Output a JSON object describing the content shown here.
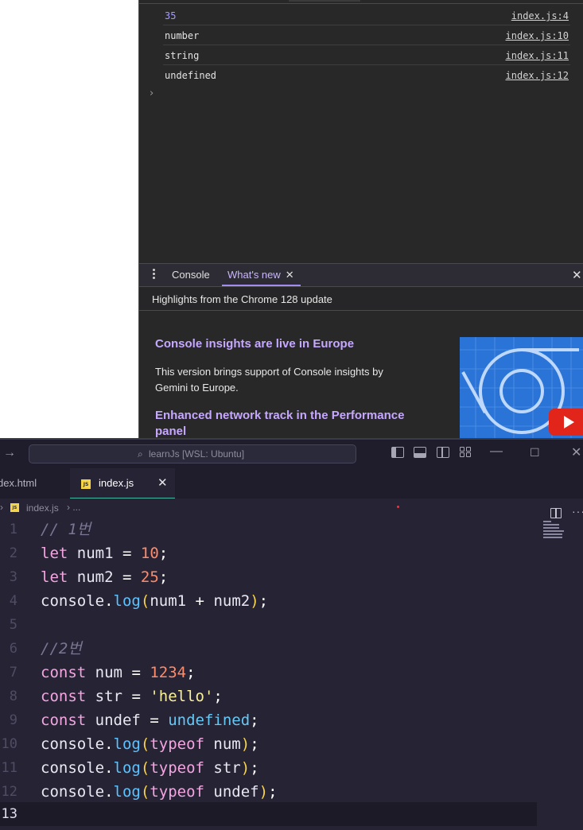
{
  "devtools": {
    "console_rows": [
      {
        "value": "35",
        "source": "index.js:4",
        "is_number": true
      },
      {
        "value": "number",
        "source": "index.js:10",
        "is_number": false
      },
      {
        "value": "string",
        "source": "index.js:11",
        "is_number": false
      },
      {
        "value": "undefined",
        "source": "index.js:12",
        "is_number": false
      }
    ],
    "prompt_symbol": "›",
    "drawer": {
      "tabs": [
        {
          "label": "Console",
          "active": false
        },
        {
          "label": "What's new",
          "active": true,
          "closable": true
        }
      ],
      "close_symbol": "✕"
    },
    "whats_new": {
      "highlights": "Highlights from the Chrome 128 update",
      "items": [
        {
          "title": "Console insights are live in Europe",
          "body": "This version brings support of Console insights by Gemini to Europe."
        },
        {
          "title": "Enhanced network track in the Performance panel",
          "title_line1": "Enhanced network track in the Performance",
          "title_line2": "panel"
        }
      ],
      "accent_color": "#c6a8ff"
    }
  },
  "vscode": {
    "command_center": "learnJs [WSL: Ubuntu]",
    "back_arrow": "→",
    "window_controls": {
      "minimize": "—",
      "maximize": "☐",
      "close": "✕"
    },
    "tabs": [
      {
        "label": "dex.html",
        "active": false
      },
      {
        "label": "index.js",
        "active": true,
        "icon": "JS",
        "close": "✕"
      }
    ],
    "more_actions": "···",
    "breadcrumb": {
      "chevron": "›",
      "file": "index.js",
      "rest": "› ..."
    },
    "editor": {
      "current_line": 13,
      "lines": [
        {
          "n": "1",
          "text": "// 1번"
        },
        {
          "n": "2",
          "text": "let num1 = 10;"
        },
        {
          "n": "3",
          "text": "let num2 = 25;"
        },
        {
          "n": "4",
          "text": "console.log(num1 + num2);"
        },
        {
          "n": "5",
          "text": ""
        },
        {
          "n": "6",
          "text": "//2번"
        },
        {
          "n": "7",
          "text": "const num = 1234;"
        },
        {
          "n": "8",
          "text": "const str = 'hello';"
        },
        {
          "n": "9",
          "text": "const undef = undefined;"
        },
        {
          "n": "10",
          "text": "console.log(typeof num);"
        },
        {
          "n": "11",
          "text": "console.log(typeof str);"
        },
        {
          "n": "12",
          "text": "console.log(typeof undef);"
        },
        {
          "n": "13",
          "text": ""
        }
      ]
    },
    "theme": {
      "editor_bg": "#262335",
      "keyword": "#f3a6e0",
      "number": "#ff8b68",
      "string": "#f9f19b",
      "function": "#5cc3ff"
    }
  }
}
